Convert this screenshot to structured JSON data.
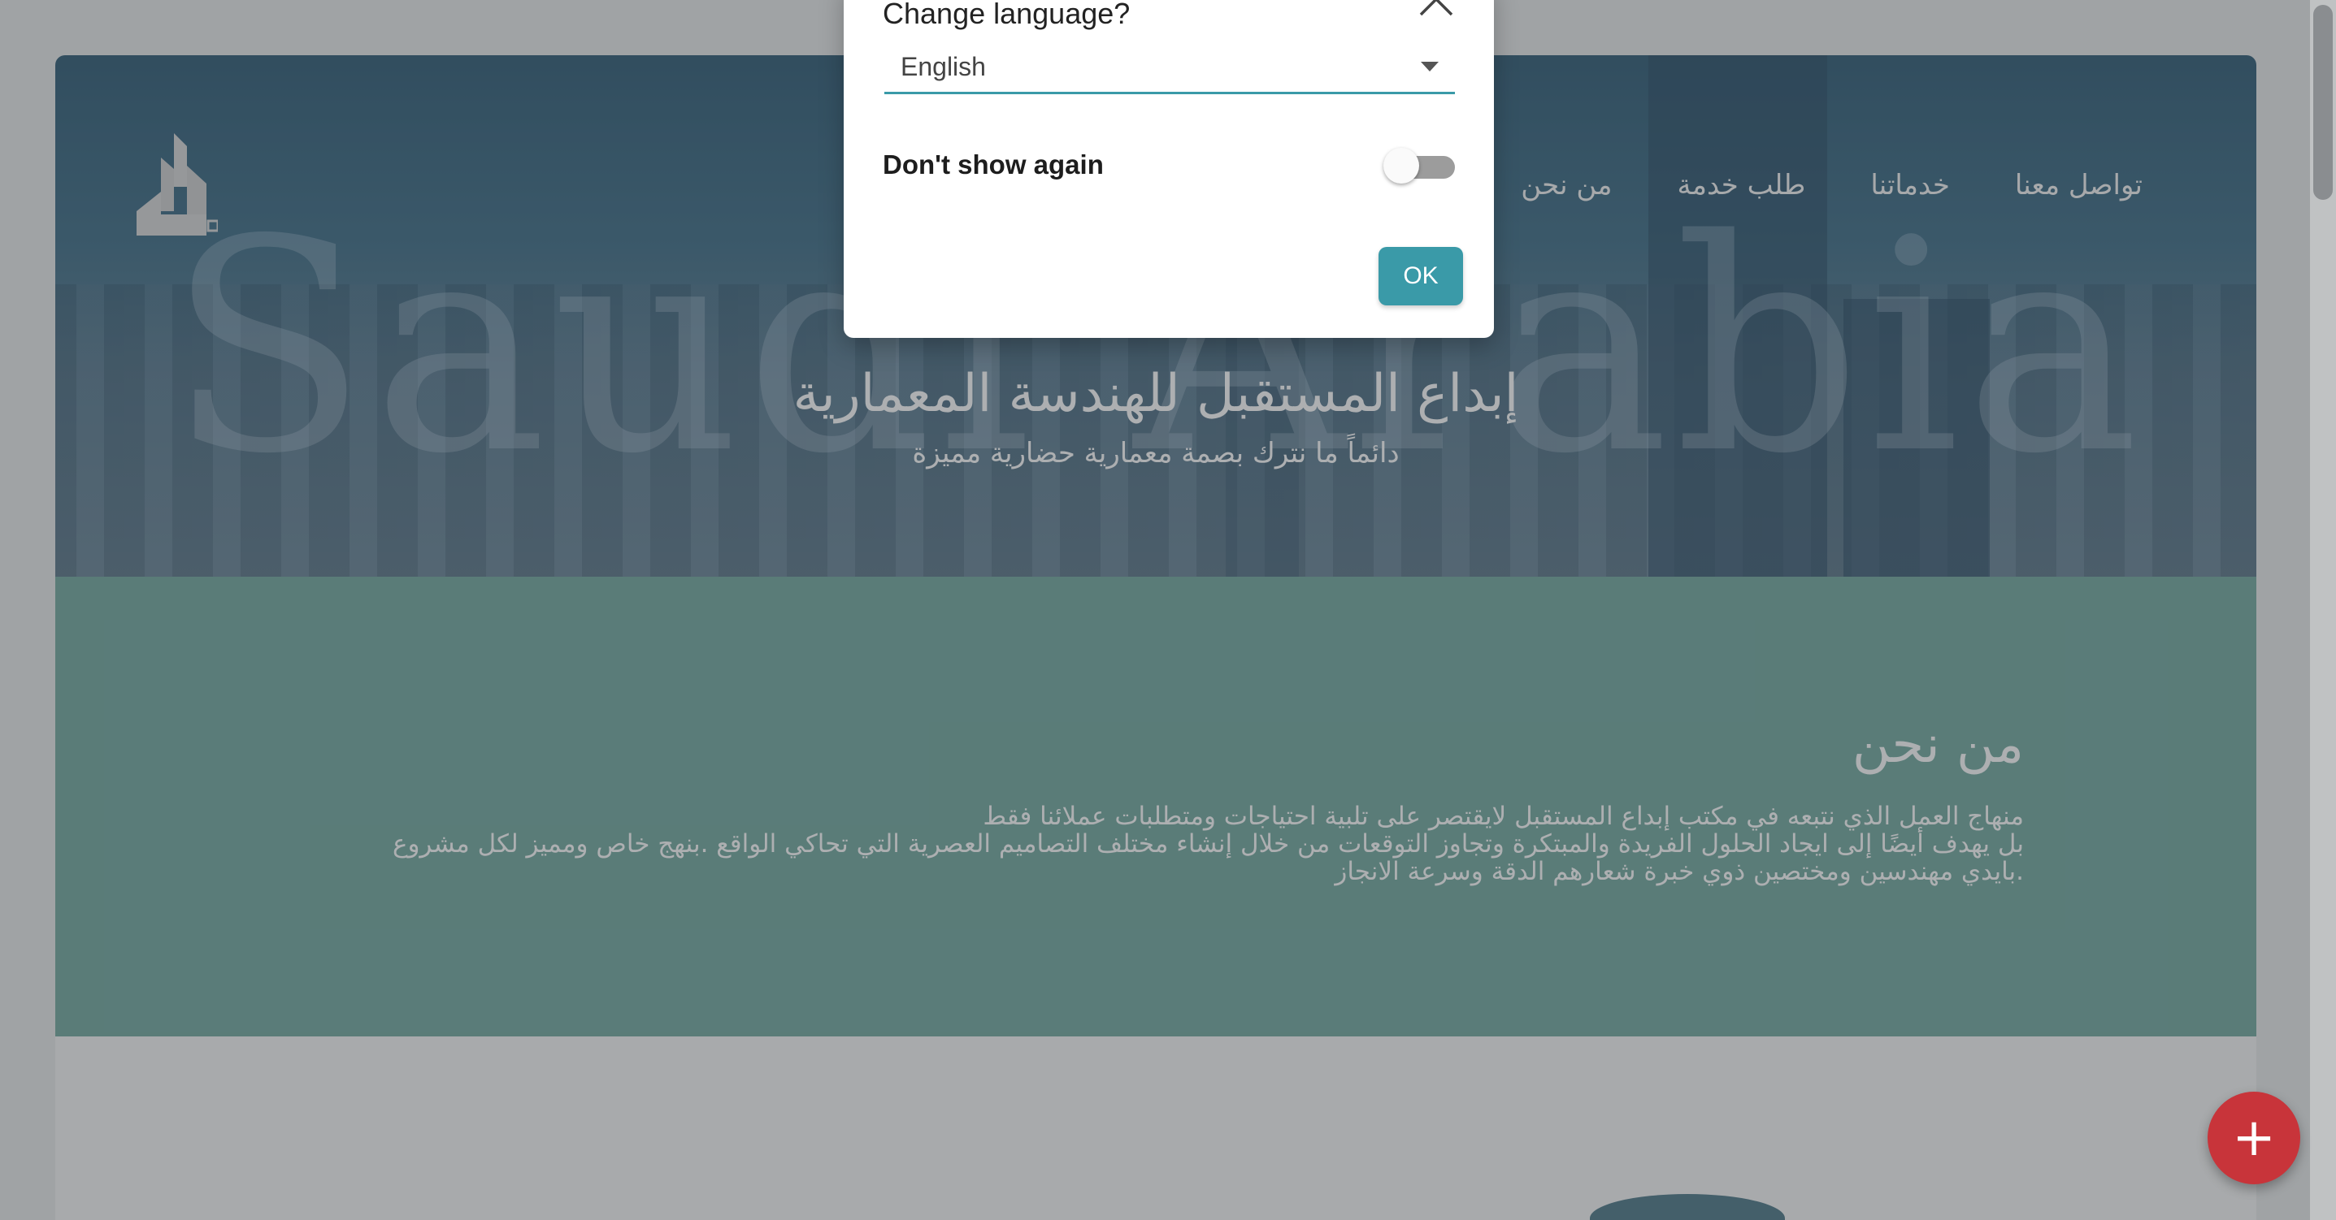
{
  "dialog": {
    "title": "Change language?",
    "close_icon": "close-icon",
    "language_select": {
      "selected": "English"
    },
    "dont_show_label": "Don't show again",
    "dont_show_enabled": false,
    "ok_label": "OK"
  },
  "hero": {
    "logo_icon": "building-logo-icon",
    "nav": [
      "تواصل معنا",
      "خدماتنا",
      "طلب خدمة",
      "من نحن"
    ],
    "watermark": "Saudi Arabia",
    "tagline_main": "إبداع المستقبل للهندسة المعمارية",
    "tagline_sub": "دائماً ما نترك بصمة معمارية حضارية مميزة"
  },
  "about": {
    "heading": "من نحن",
    "lines": [
      "منهاج العمل الذي نتبعه في مكتب إبداع المستقبل لايقتصر على تلبية احتياجات ومتطلبات عملائنا فقط",
      "بل يهدف أيضًا إلى ايجاد الحلول الفريدة والمبتكرة وتجاوز التوقعات من خلال إنشاء مختلف التصاميم العصرية التي تحاكي الواقع .بنهج خاص ومميز لكل مشروع",
      ".بايدي مهندسين ومختصين ذوي خبرة شعارهم الدقة وسرعة الانجاز"
    ]
  },
  "fab": {
    "icon": "plus-icon",
    "label": "+"
  },
  "colors": {
    "accent": "#3a9aa8",
    "about_bg": "#70a89e",
    "fab": "#c8343a",
    "hero_bg": "#2b5872"
  }
}
